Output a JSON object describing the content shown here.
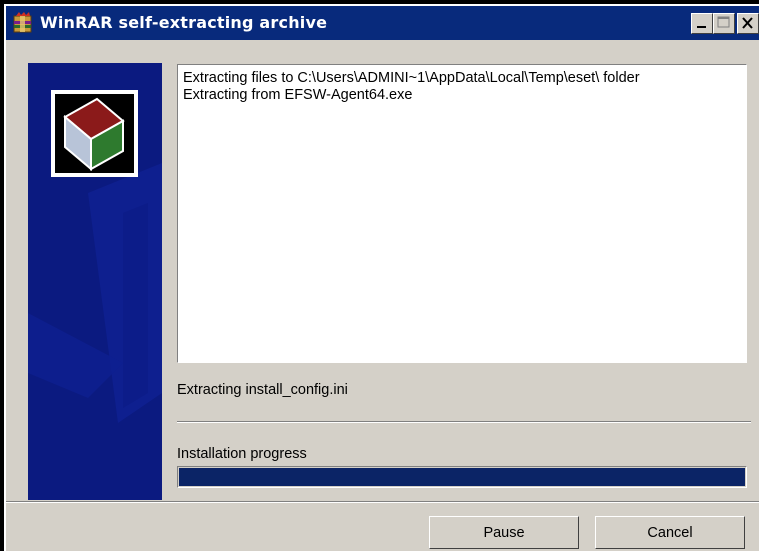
{
  "window": {
    "title": "WinRAR self-extracting archive",
    "icon": "winrar-archive-icon",
    "controls": {
      "minimize": "minimize-icon",
      "maximize": "maximize-icon",
      "close": "close-icon"
    }
  },
  "log": {
    "lines": [
      "Extracting files to C:\\Users\\ADMINI~1\\AppData\\Local\\Temp\\eset\\ folder",
      "Extracting from EFSW-Agent64.exe"
    ]
  },
  "status": {
    "current_file": "Extracting install_config.ini"
  },
  "progress": {
    "label": "Installation progress",
    "fraction": 1.0,
    "color": "#0b2466"
  },
  "buttons": {
    "pause": "Pause",
    "cancel": "Cancel"
  },
  "colors": {
    "titlebar": "#082a7c",
    "panel": "#0b1b86",
    "face": "#d4d0c8"
  }
}
